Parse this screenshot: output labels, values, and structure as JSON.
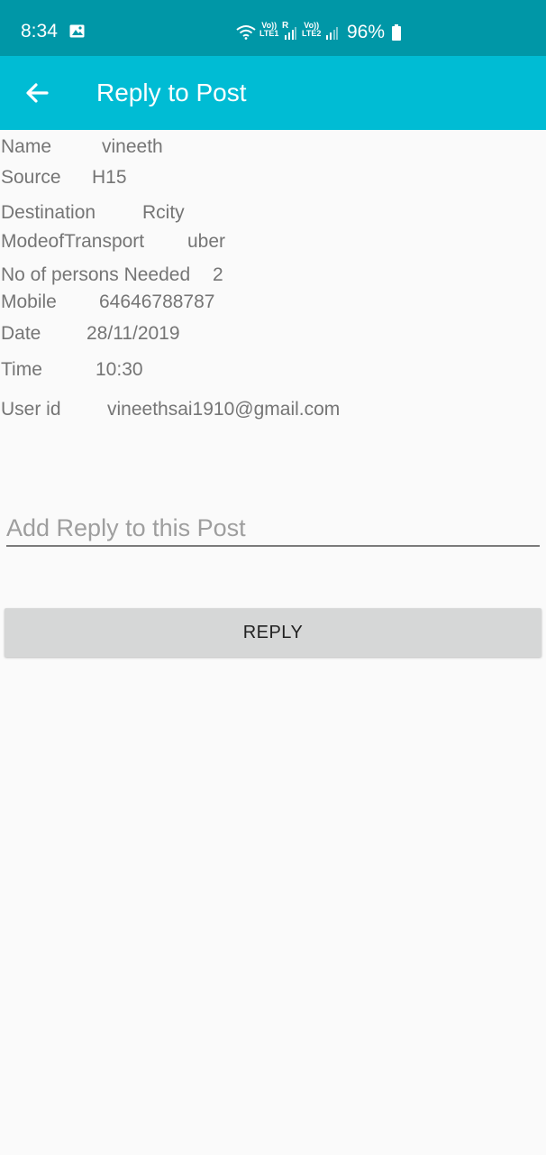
{
  "status_bar": {
    "time": "8:34",
    "net1_top": "Vo))",
    "net1_bottom": "LTE1",
    "net1_roaming": "R",
    "net2_top": "Vo))",
    "net2_bottom": "LTE2",
    "battery": "96%",
    "icons": [
      "image-icon",
      "wifi-icon",
      "signal-icon",
      "battery-icon"
    ]
  },
  "app_bar": {
    "title": "Reply to Post",
    "back_icon": "arrow-left-icon",
    "color": "#00bcd4"
  },
  "post": {
    "name_label": "Name",
    "name_value": "vineeth",
    "source_label": "Source",
    "source_value": "H15",
    "destination_label": "Destination",
    "destination_value": "Rcity",
    "mode_label": "ModeofTransport",
    "mode_value": "uber",
    "persons_label": "No of persons Needed",
    "persons_value": "2",
    "mobile_label": "Mobile",
    "mobile_value": "64646788787",
    "date_label": "Date",
    "date_value": "28/11/2019",
    "time_label": "Time",
    "time_value": "10:30",
    "userid_label": "User id",
    "userid_value": "vineethsai1910@gmail.com"
  },
  "reply_form": {
    "value": "",
    "placeholder": "Add Reply to this Post",
    "button_label": "REPLY"
  }
}
